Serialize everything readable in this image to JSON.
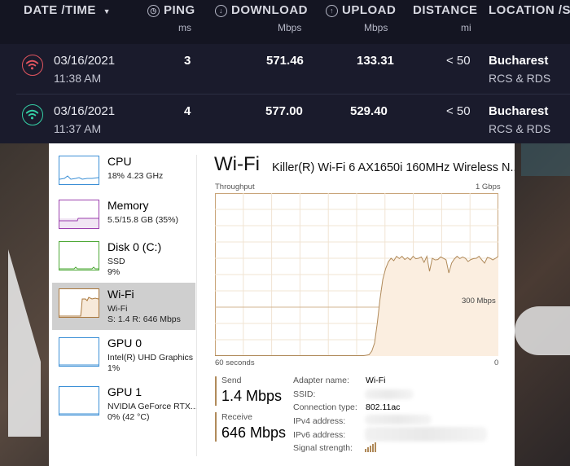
{
  "speedtest": {
    "columns": {
      "datetime": "DATE /TIME",
      "sort_icon": "▼",
      "ping": "PING",
      "ping_unit": "ms",
      "download": "DOWNLOAD",
      "download_unit": "Mbps",
      "upload": "UPLOAD",
      "upload_unit": "Mbps",
      "distance": "DISTANCE",
      "distance_unit": "mi",
      "location": "LOCATION /S"
    },
    "rows": [
      {
        "date": "03/16/2021",
        "time": "11:38 AM",
        "ping": "3",
        "download": "571.46",
        "upload": "133.31",
        "distance": "< 50",
        "city": "Bucharest",
        "isp": "RCS & RDS",
        "icon_color": "#e2555f"
      },
      {
        "date": "03/16/2021",
        "time": "11:37 AM",
        "ping": "4",
        "download": "577.00",
        "upload": "529.40",
        "distance": "< 50",
        "city": "Bucharest",
        "isp": "RCS & RDS",
        "icon_color": "#35d0a6"
      }
    ]
  },
  "taskmanager": {
    "sidebar": [
      {
        "name": "CPU",
        "detail1": "18% 4.23 GHz",
        "detail2": "",
        "color": "#3b8fd6"
      },
      {
        "name": "Memory",
        "detail1": "5.5/15.8 GB (35%)",
        "detail2": "",
        "color": "#9b3fae"
      },
      {
        "name": "Disk 0 (C:)",
        "detail1": "SSD",
        "detail2": "9%",
        "color": "#4da836"
      },
      {
        "name": "Wi-Fi",
        "detail1": "Wi-Fi",
        "detail2": "S: 1.4 R: 646 Mbps",
        "color": "#a9763a"
      },
      {
        "name": "GPU 0",
        "detail1": "Intel(R) UHD Graphics",
        "detail2": "1%",
        "color": "#3b8fd6"
      },
      {
        "name": "GPU 1",
        "detail1": "NVIDIA GeForce RTX...",
        "detail2": "0% (42 °C)",
        "color": "#3b8fd6"
      }
    ],
    "selected": "Wi-Fi",
    "title": "Wi-Fi",
    "adapter_title": "Killer(R) Wi-Fi 6 AX1650i 160MHz Wireless N...",
    "graph": {
      "top_left": "Throughput",
      "top_right": "1 Gbps",
      "mid_label": "300 Mbps",
      "bottom_left": "60 seconds",
      "bottom_right": "0",
      "max_mbps": 1000,
      "window_seconds": 60,
      "throughput_mbps": [
        0,
        0,
        0,
        0,
        0,
        0,
        0,
        0,
        0,
        0,
        0,
        0,
        0,
        0,
        0,
        0,
        0,
        0,
        0,
        0,
        0,
        0,
        0,
        0,
        0,
        0,
        0,
        0,
        0,
        0,
        0,
        0,
        0,
        0,
        0,
        0,
        0,
        0,
        0,
        0,
        0,
        0,
        0,
        0,
        0,
        0,
        0,
        0,
        0,
        0,
        0,
        0,
        0,
        0,
        2,
        5,
        8,
        30,
        80,
        200,
        350,
        470,
        535,
        578,
        600,
        585,
        612,
        598,
        612,
        592,
        604,
        590,
        612,
        597,
        600,
        608,
        575,
        612,
        520,
        600,
        590,
        592,
        608,
        600,
        590,
        510,
        570,
        595,
        612,
        598,
        608,
        600,
        580,
        592,
        598,
        600,
        612,
        590,
        570,
        605,
        600,
        590,
        600,
        612
      ]
    },
    "send": {
      "label": "Send",
      "value": "1.4 Mbps"
    },
    "receive": {
      "label": "Receive",
      "value": "646 Mbps"
    },
    "details": [
      {
        "key": "Adapter name:",
        "value": "Wi-Fi"
      },
      {
        "key": "SSID:",
        "value": ""
      },
      {
        "key": "Connection type:",
        "value": "802.11ac"
      },
      {
        "key": "IPv4 address:",
        "value": ""
      },
      {
        "key": "IPv6 address:",
        "value": ""
      },
      {
        "key": "Signal strength:",
        "value": ""
      }
    ],
    "signal_icon": "signal-strength-icon"
  }
}
